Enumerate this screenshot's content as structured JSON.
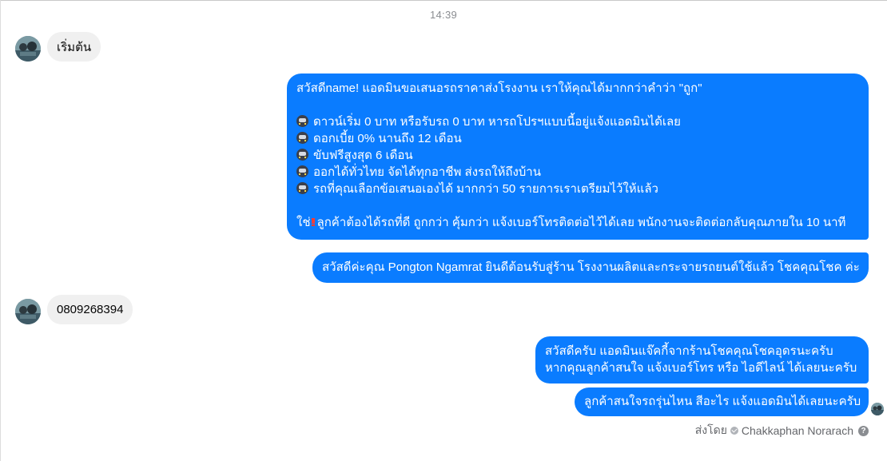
{
  "timestamp": "14:39",
  "messages": {
    "incoming_1": "เริ่มต้น",
    "outgoing_1": {
      "line_1": "สวัสดีname! แอดมินขอเสนอรถราคาส่งโรงงาน เราให้คุณได้มากกว่าคำว่า \"ถูก\"",
      "bullet_1": "ดาวน์เริ่ม 0 บาท หรือรับรถ 0 บาท หารถโปรฯแบบนี้อยู่แจ้งแอดมินได้เลย",
      "bullet_2": "ดอกเบี้ย 0% นานถึง 12 เดือน",
      "bullet_3": "ขับฟรีสูงสุด 6 เดือน",
      "bullet_4": "ออกได้ทั่วไทย จัดได้ทุกอาชีพ ส่งรถให้ถึงบ้าน",
      "bullet_5": "รถที่คุณเลือกข้อเสนอเองได้ มากกว่า 50 รายการเราเตรียมไว้ให้แล้ว",
      "closing_prefix": "ใช่",
      "closing_text": "ลูกค้าต้องได้รถที่ดี ถูกกว่า คุ้มกว่า แจ้งเบอร์โทรติดต่อไว้ได้เลย พนักงานจะติดต่อกลับคุณภายใน 10 นาที"
    },
    "outgoing_2": "สวัสดีค่ะคุณ Pongton Ngamrat ยินดีต้อนรับสู่ร้าน โรงงานผลิตและกระจายรถยนต์ใช้แล้ว โชคคุณโชค ค่ะ",
    "incoming_2": "0809268394",
    "outgoing_3": {
      "line_1": "สวัสดีครับ แอดมินแจ๊คกี้จากร้านโชคคุณโชคอุดรนะครับ",
      "line_2": "หากคุณลูกค้าสนใจ แจ้งเบอร์โทร หรือ ไอดีไลน์ ได้เลยนะครับ"
    },
    "outgoing_4": "ลูกค้าสนใจรถรุ่นไหน สีอะไร แจ้งแอดมินได้เลยนะครับ"
  },
  "sent_by": {
    "label": "ส่งโดย",
    "name": "Chakkaphan Norarach"
  },
  "icons": {
    "bullet": "car-emoji-icon",
    "exclamation": "double-exclamation-icon",
    "verified": "check-circle-icon",
    "help": "question-circle-icon"
  },
  "colors": {
    "outgoing_bubble": "#0a7cff",
    "incoming_bubble": "#f0f0f0",
    "meta_text": "#8a8d91"
  }
}
